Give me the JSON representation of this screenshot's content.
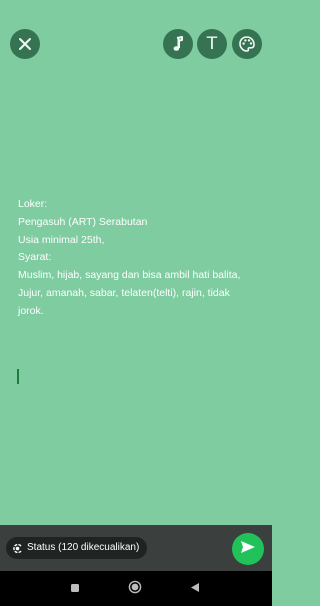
{
  "colors": {
    "background": "#7ecca0",
    "button_bg": "#2e6a4a",
    "bottom_bar": "#3b3f3d",
    "send_button": "#22c25a",
    "nav_bar": "#000000"
  },
  "toolbar": {
    "close_icon": "close-icon",
    "music_icon": "music-note-icon",
    "text_button_label": "T",
    "palette_icon": "palette-icon"
  },
  "status_text": "Loker:\nPengasuh (ART) Serabutan\nUsia minimal 25th,\nSyarat:\nMuslim, hijab, sayang dan bisa ambil hati balita,\nJujur, amanah, sabar, telaten(telti), rajin, tidak jorok.",
  "footer": {
    "audience_label": "Status (120 dikecualikan)",
    "audience_icon": "status-privacy-icon",
    "send_icon": "send-icon"
  },
  "navigation": {
    "recents_icon": "recents-icon",
    "home_icon": "home-icon",
    "back_icon": "back-icon"
  }
}
